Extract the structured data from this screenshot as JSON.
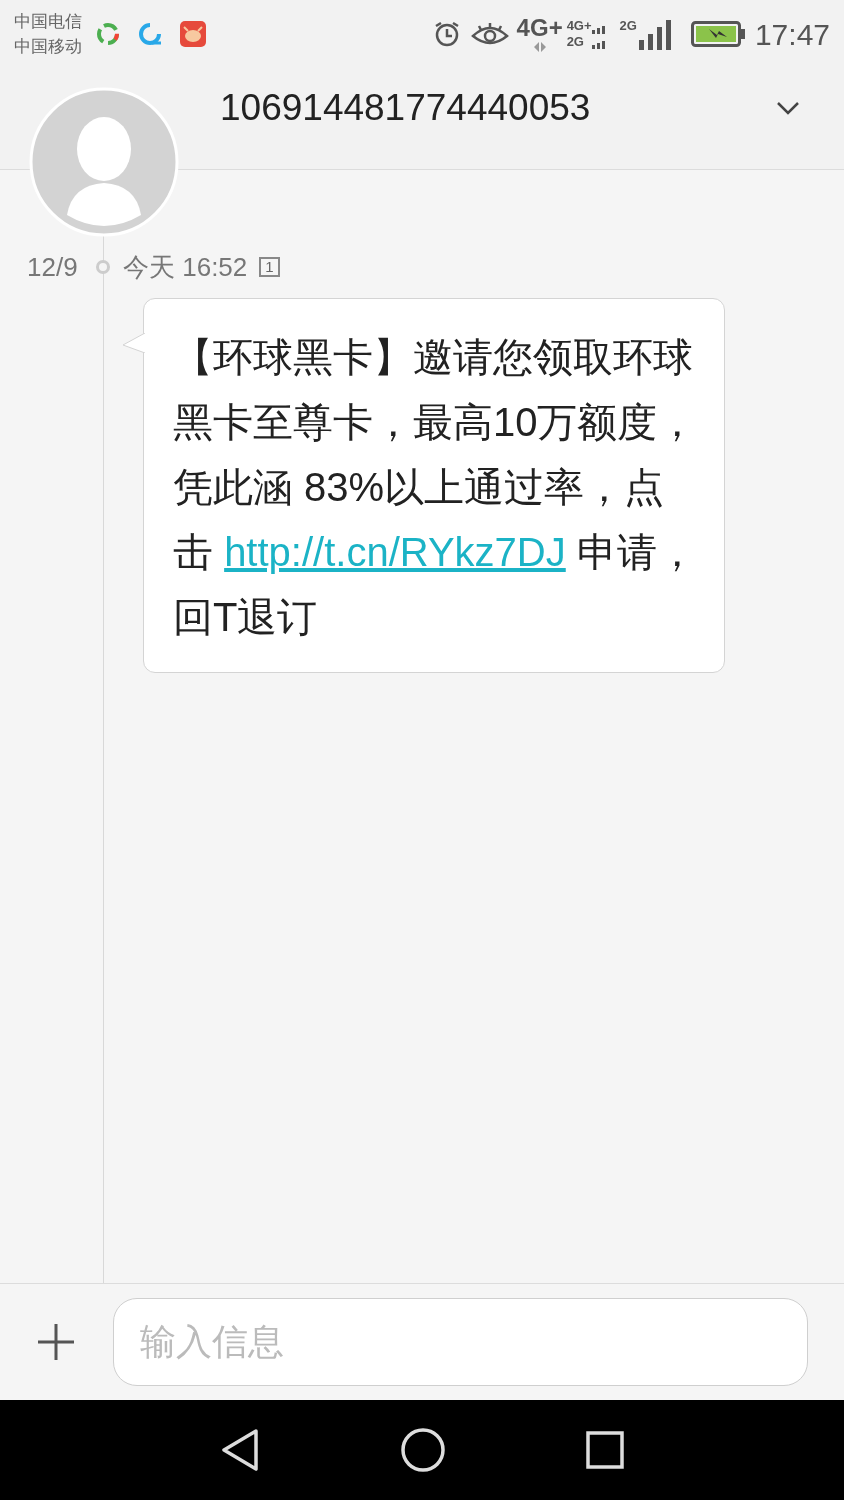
{
  "status_bar": {
    "carriers": [
      "中国电信",
      "中国移动"
    ],
    "network_labels": [
      "4G+",
      "4G+",
      "2G",
      "2G"
    ],
    "time": "17:47"
  },
  "header": {
    "title": "106914481774440053"
  },
  "thread": {
    "date": "12/9",
    "time": "今天 16:52",
    "sim": "1"
  },
  "message": {
    "text_before": "【环球黑卡】邀请您领取环球黑卡至尊卡，最高10万额度，凭此涵 83%以上通过率，点击 ",
    "link": "http://t.cn/RYkz7DJ",
    "text_after": " 申请，回T退订"
  },
  "composer": {
    "placeholder": "输入信息"
  }
}
